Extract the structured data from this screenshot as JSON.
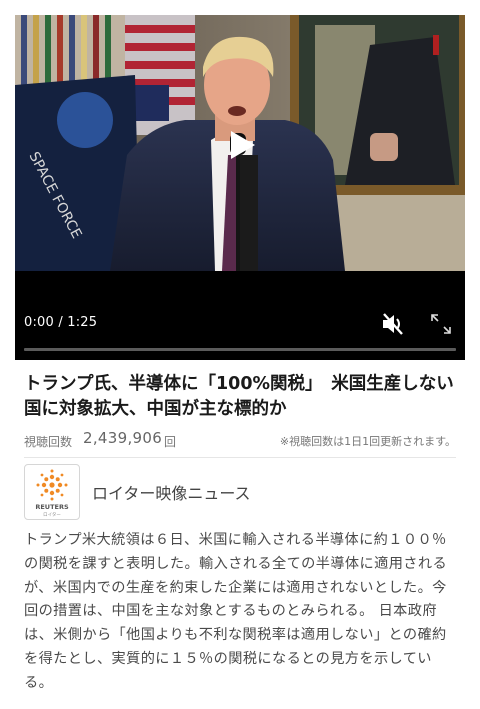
{
  "video": {
    "time_display": "0:00 / 1:25",
    "progress_fraction": 0,
    "mute_icon": "speaker-muted-icon",
    "fullscreen_icon": "expand-icon",
    "play_icon": "play-icon",
    "patch_text": "SPACE FORCE"
  },
  "article": {
    "headline": "トランプ氏、半導体に「100%関税」　米国生産しない国に対象拡大、中国が主な標的か",
    "views_label": "視聴回数",
    "views_count": "2,439,906",
    "views_unit": "回",
    "views_note": "※視聴回数は1日1回更新されます。",
    "channel_name": "ロイター映像ニュース",
    "channel_logo_text": "REUTERS",
    "channel_logo_subtext": "ロイター",
    "description": "トランプ米大統領は６日、米国に輸入される半導体に約１００％の関税を課すと表明した。輸入される全ての半導体に適用されるが、米国内での生産を約束した企業には適用されないとした。今回の措置は、中国を主な対象とするものとみられる。 日本政府は、米側から「他国よりも不利な関税率は適用しない」との確約を得たとし、実質的に１５％の関税になるとの見方を示している。"
  },
  "colors": {
    "player_bg": "#000000",
    "headline": "#1a1a1a",
    "muted_text": "#777777",
    "body_text": "#4a4a4a",
    "reuters_orange": "#f08a24"
  }
}
